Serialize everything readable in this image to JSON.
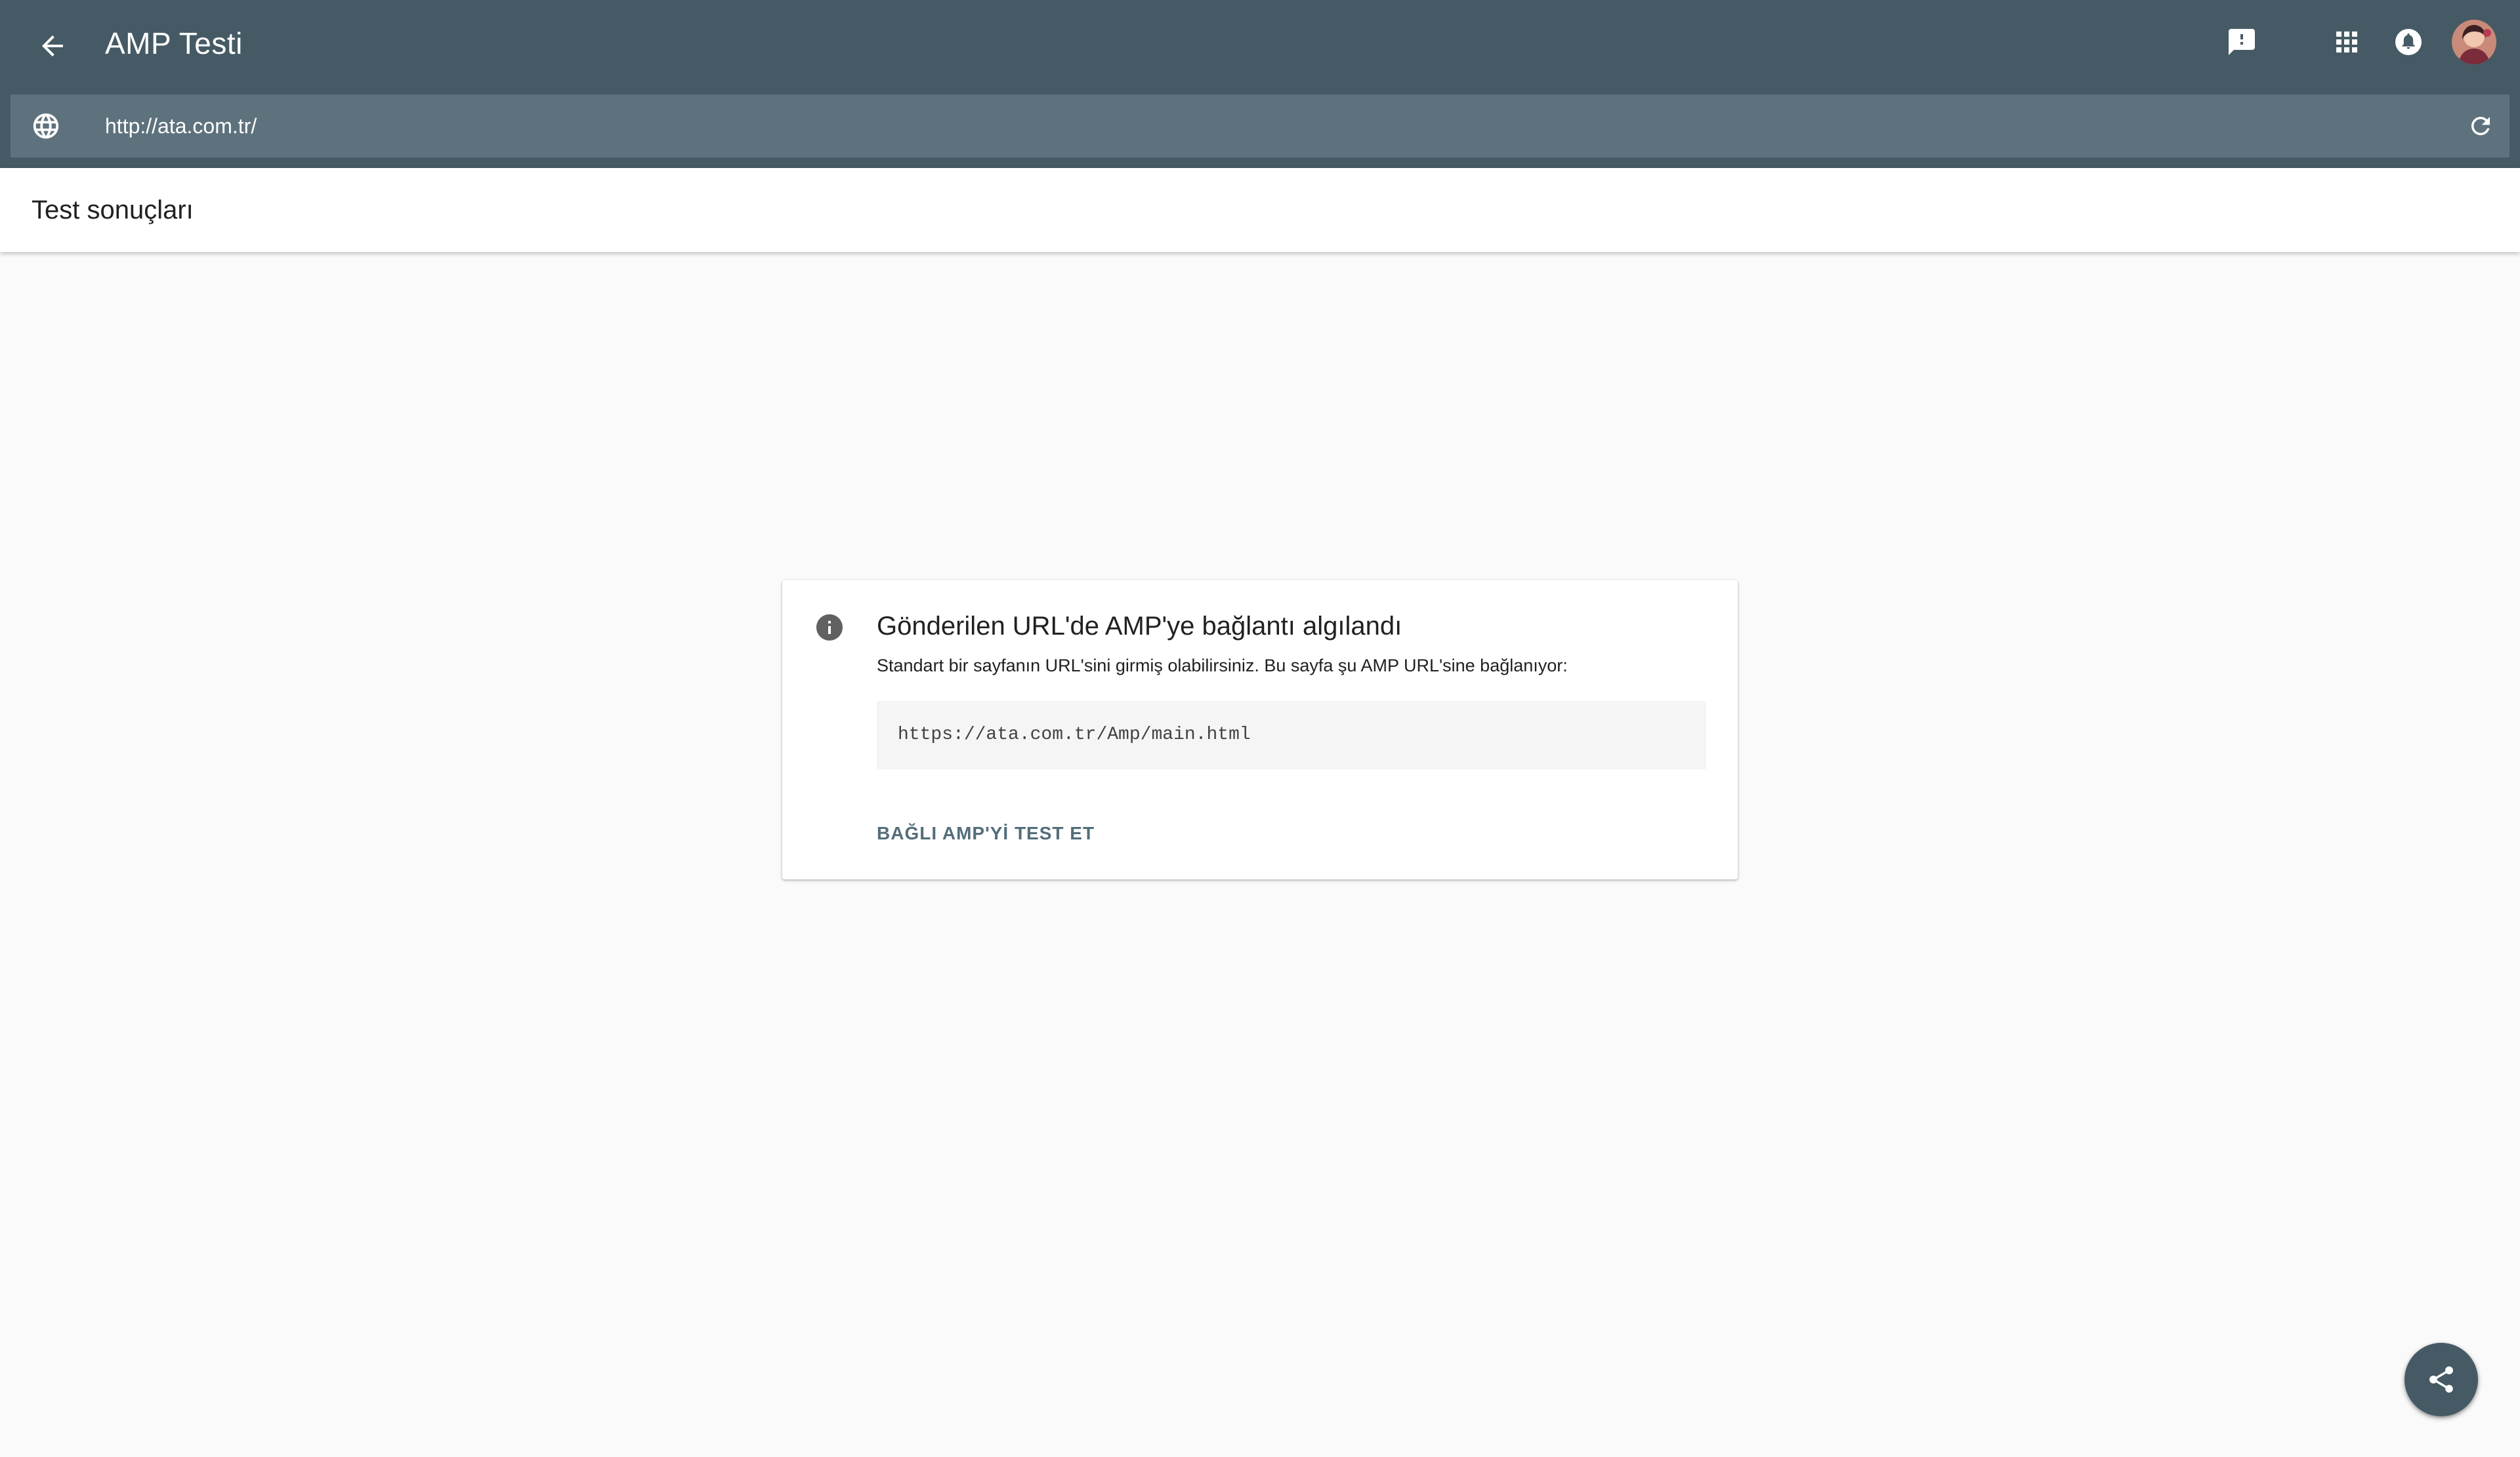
{
  "appbar": {
    "title": "AMP Testi",
    "background": "#455a64",
    "icons": {
      "back": "arrow-back-icon",
      "feedback": "feedback-icon",
      "apps": "apps-grid-icon",
      "notifications": "notifications-icon",
      "avatar": "avatar"
    }
  },
  "urlbar": {
    "value": "http://ata.com.tr/",
    "icons": {
      "globe": "globe-icon",
      "reload": "reload-icon"
    }
  },
  "subheader": {
    "title": "Test sonuçları"
  },
  "card": {
    "title": "Gönderilen URL'de AMP'ye bağlantı algılandı",
    "description": "Standart bir sayfanın URL'sini girmiş olabilirsiniz. Bu sayfa şu AMP URL'sine bağlanıyor:",
    "amp_url": "https://ata.com.tr/Amp/main.html",
    "action_label": "BAĞLI AMP'Yİ TEST ET",
    "accent": "#546e7a"
  },
  "fab": {
    "icon": "share-icon",
    "background": "#455a64"
  }
}
